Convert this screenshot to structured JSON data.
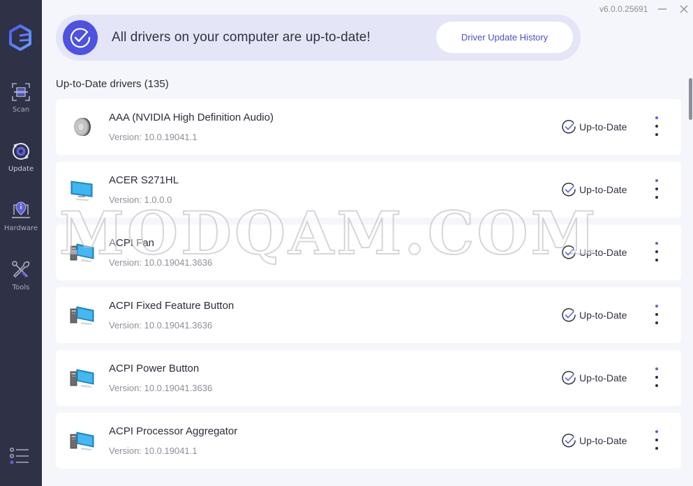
{
  "app": {
    "version": "v6.0.0.25691"
  },
  "window_controls": {
    "minimize": "minimize-icon",
    "close": "close-icon"
  },
  "sidebar": {
    "logo": "app-logo",
    "items": [
      {
        "label": "Scan",
        "icon": "scan-icon",
        "active": false
      },
      {
        "label": "Update",
        "icon": "update-icon",
        "active": true
      },
      {
        "label": "Hardware",
        "icon": "hardware-icon",
        "active": false
      },
      {
        "label": "Tools",
        "icon": "tools-icon",
        "active": false
      }
    ],
    "menu_icon": "menu-list-icon"
  },
  "banner": {
    "message": "All drivers on your computer are up-to-date!",
    "button_label": "Driver Update History",
    "icon": "check-circle-icon"
  },
  "section": {
    "title": "Up-to-Date drivers (135)"
  },
  "drivers": [
    {
      "name": "AAA (NVIDIA High Definition Audio)",
      "version": "Version: 10.0.19041.1",
      "status": "Up-to-Date",
      "icon": "speaker-icon"
    },
    {
      "name": "ACER S271HL",
      "version": "Version: 1.0.0.0",
      "status": "Up-to-Date",
      "icon": "monitor-icon"
    },
    {
      "name": "ACPI Fan",
      "version": "Version: 10.0.19041.3636",
      "status": "Up-to-Date",
      "icon": "computer-icon"
    },
    {
      "name": "ACPI Fixed Feature Button",
      "version": "Version: 10.0.19041.3636",
      "status": "Up-to-Date",
      "icon": "computer-icon"
    },
    {
      "name": "ACPI Power Button",
      "version": "Version: 10.0.19041.3636",
      "status": "Up-to-Date",
      "icon": "computer-icon"
    },
    {
      "name": "ACPI Processor Aggregator",
      "version": "Version: 10.0.19041.1",
      "status": "Up-to-Date",
      "icon": "computer-icon"
    }
  ],
  "watermark": "MODQAM.COM",
  "colors": {
    "sidebar_bg": "#2f3146",
    "accent": "#4d52e1",
    "banner_bg": "#e4e5f7",
    "content_bg": "#f5f6fb"
  }
}
